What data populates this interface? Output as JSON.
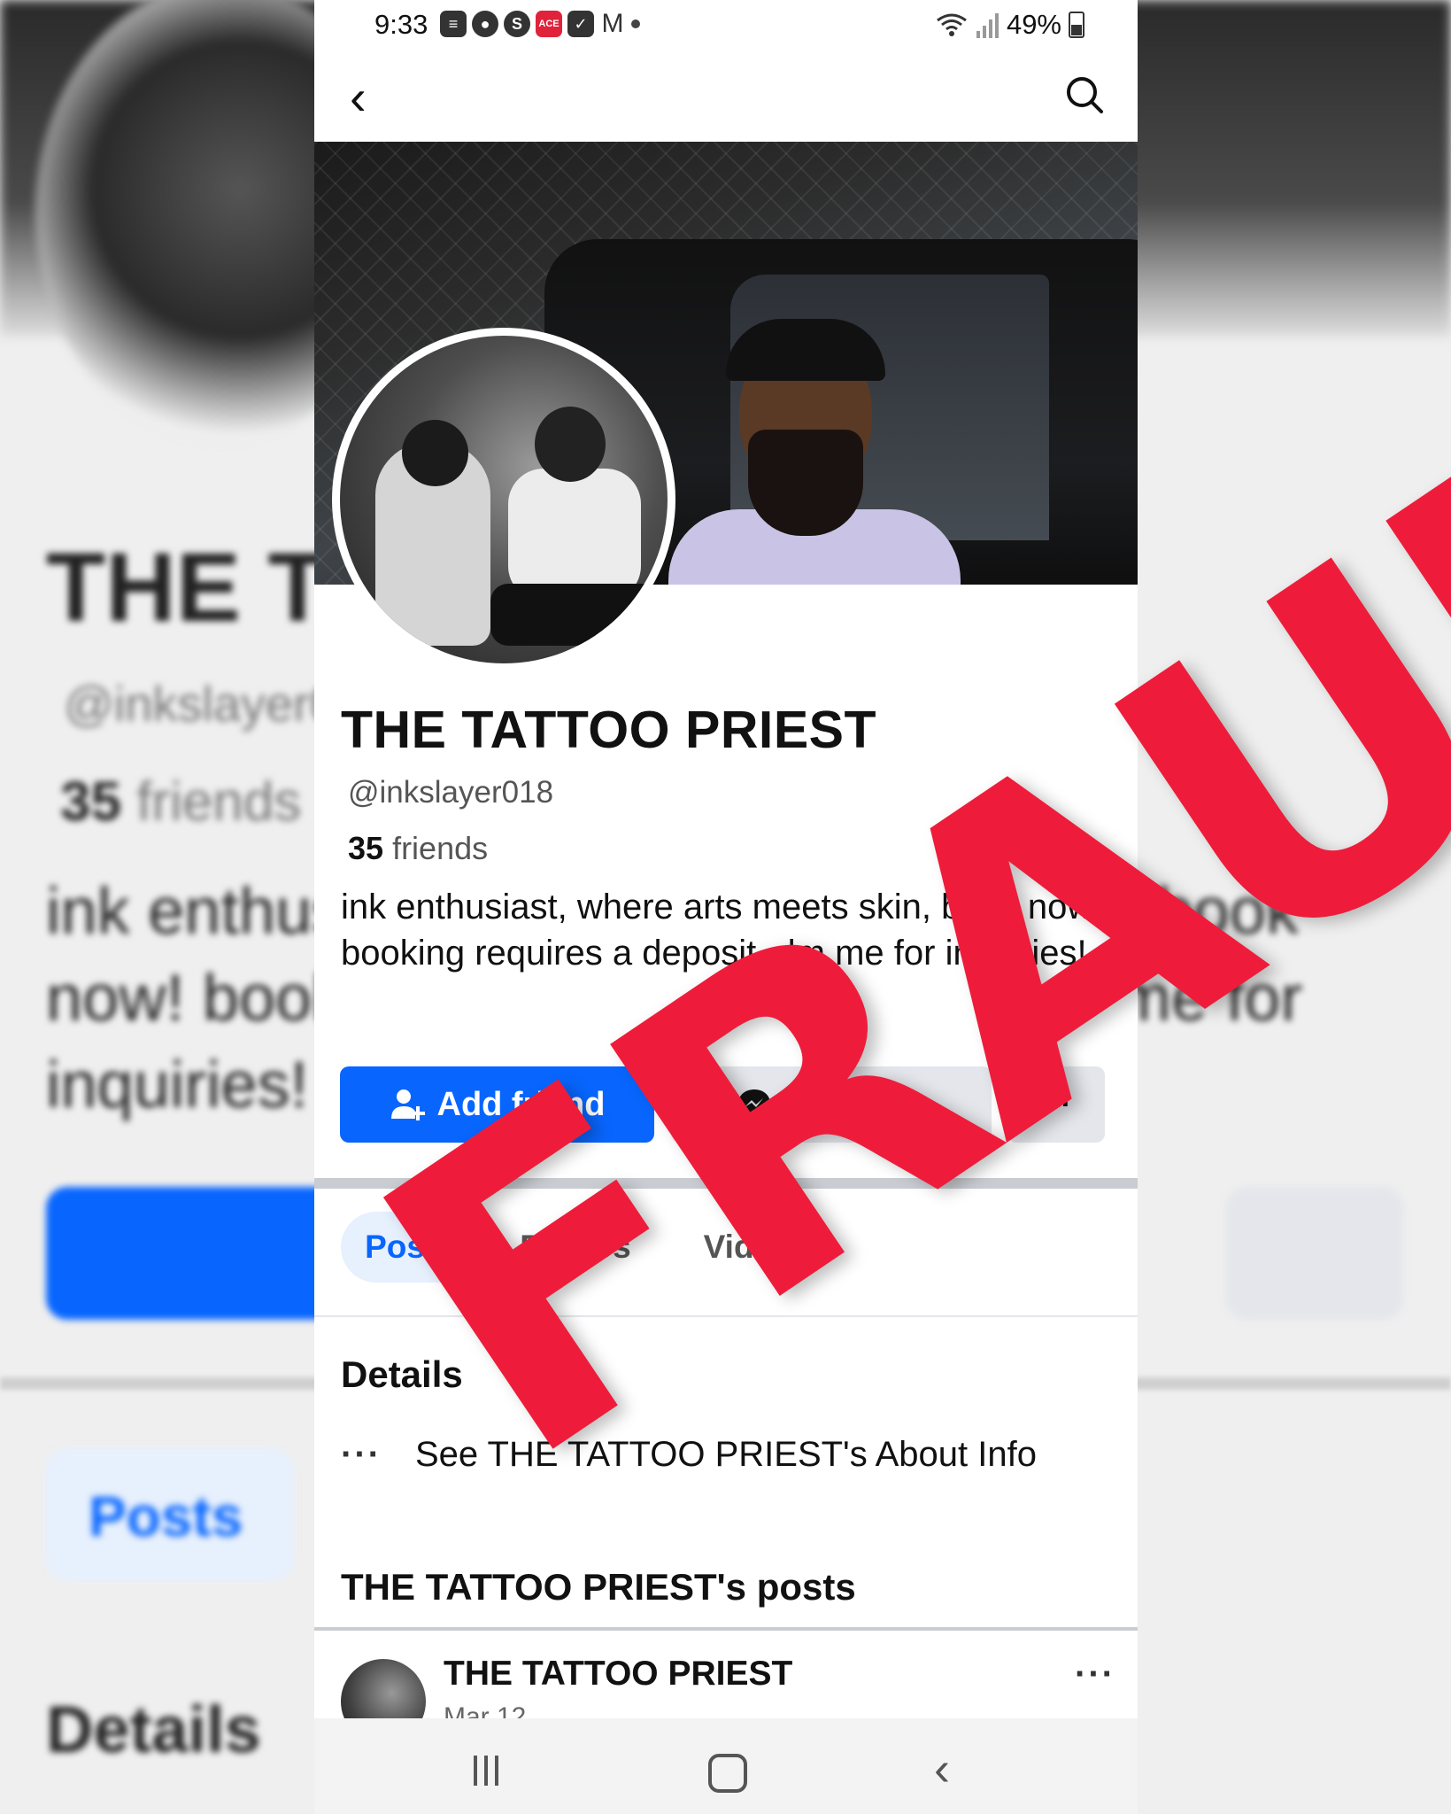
{
  "status_bar": {
    "time": "9:33",
    "battery": "49%",
    "notification_icons": [
      "message-icon",
      "account-icon",
      "s-app-icon",
      "ace-app-icon",
      "checkbox-icon",
      "gmail-icon",
      "more-dot-icon"
    ],
    "ace_label": "ACE"
  },
  "profile": {
    "name": "THE TATTOO PRIEST",
    "handle": "@inkslayer018",
    "friends_count": "35",
    "friends_label": "friends",
    "bio": "ink enthusiast, where arts meets skin, book now! booking requires a deposit, dm me for inquiries!"
  },
  "actions": {
    "add_friend": "Add friend",
    "message": "Message",
    "more": "···"
  },
  "tabs": [
    "Posts",
    "Photos",
    "Videos"
  ],
  "details": {
    "title": "Details",
    "about_link": "See THE TATTOO PRIEST's About Info",
    "dots": "···"
  },
  "posts": {
    "title": "THE TATTOO PRIEST's posts",
    "first_post": {
      "author": "THE TATTOO PRIEST",
      "date": "Mar 12",
      "more": "···"
    }
  },
  "overlay": {
    "stamp": "FRAUD",
    "color": "#ee1c3a"
  },
  "colors": {
    "primary": "#0866ff",
    "secondary_button": "#e4e6eb"
  }
}
